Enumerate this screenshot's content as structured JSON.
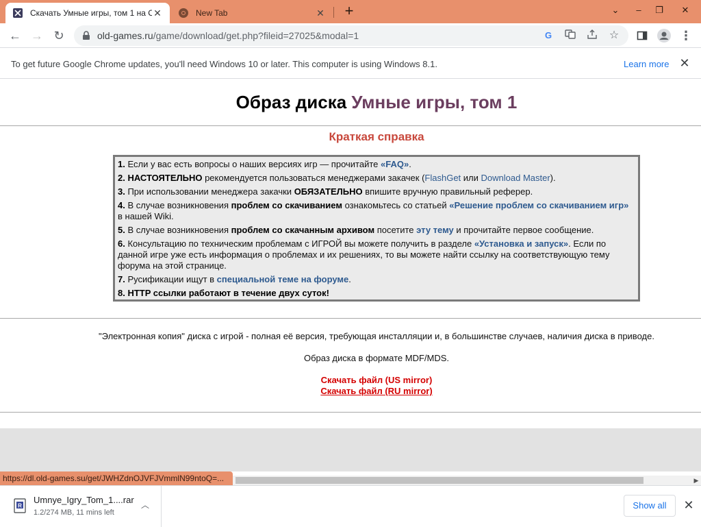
{
  "tabs": [
    {
      "title": "Скачать Умные игры, том 1 на С",
      "icon": "site-favicon"
    },
    {
      "title": "New Tab",
      "icon": "chrome-icon"
    }
  ],
  "window_controls": [
    "⌄",
    "–",
    "❐",
    "✕"
  ],
  "address": {
    "domain": "old-games.ru",
    "path": "/game/download/get.php?fileid=27025&modal=1"
  },
  "infobar": {
    "message": "To get future Google Chrome updates, you'll need Windows 10 or later. This computer is using Windows 8.1.",
    "link": "Learn more"
  },
  "page": {
    "title_prefix": "Образ диска ",
    "title_game": "Умные игры, том 1",
    "help_heading": "Краткая справка",
    "help_items": [
      {
        "num": "1.",
        "t1": " Если у вас есть вопросы о наших версиях игр — прочитайте ",
        "link": "«FAQ»",
        "t2": "."
      },
      {
        "num": "2.",
        "b1": " НАСТОЯТЕЛЬНО",
        "t1": " рекомендуется пользоваться менеджерами закачек (",
        "link1": "FlashGet",
        "t2": " или ",
        "link2": "Download Master",
        "t3": ")."
      },
      {
        "num": "3.",
        "t1": " При использовании менеджера закачки ",
        "b1": "ОБЯЗАТЕЛЬНО",
        "t2": " впишите вручную правильный реферер."
      },
      {
        "num": "4.",
        "t1": " В случае возникновения ",
        "b1": "проблем со скачиванием",
        "t2": " ознакомьтесь со статьей ",
        "link": "«Решение проблем со скачиванием игр»",
        "t3": " в нашей Wiki."
      },
      {
        "num": "5.",
        "t1": " В случае возникновения ",
        "b1": "проблем со скачанным архивом",
        "t2": " посетите ",
        "link": "эту тему",
        "t3": " и прочитайте первое сообщение."
      },
      {
        "num": "6.",
        "t1": " Консультацию по техническим проблемам с ИГРОЙ вы можете получить в разделе ",
        "link": "«Установка и запуск»",
        "t2": ". Если по данной игре уже есть информация о проблемах и их решениях, то вы можете найти ссылку на соответствующую тему форума на этой странице."
      },
      {
        "num": "7.",
        "t1": " Русификации ищут в ",
        "link": "специальной теме на форуме",
        "t2": "."
      },
      {
        "num": "8.",
        "b1": " HTTP ссылки работают в течение двух суток!"
      }
    ],
    "description": "\"Электронная копия\" диска с игрой - полная её версия, требующая инсталляции и, в большинстве случаев, наличия диска в приводе.",
    "format": "Образ диска в формате MDF/MDS.",
    "download_us": "Скачать файл (US mirror)",
    "download_ru": "Скачать файл (RU mirror)"
  },
  "status_bar_url": "https://dl.old-games.su/get/JWHZdnOJVFJVmmlN99ntoQ=...",
  "download_bar": {
    "file_name": "Umnye_Igry_Tom_1....rar",
    "status": "1.2/274 MB, 11 mins left",
    "show_all": "Show all"
  },
  "colors": {
    "tabbar": "#e8906c",
    "title_game": "#6b3e5f",
    "help_heading": "#c8483c",
    "download_link": "#d40000",
    "link": "#2e5a8f"
  }
}
